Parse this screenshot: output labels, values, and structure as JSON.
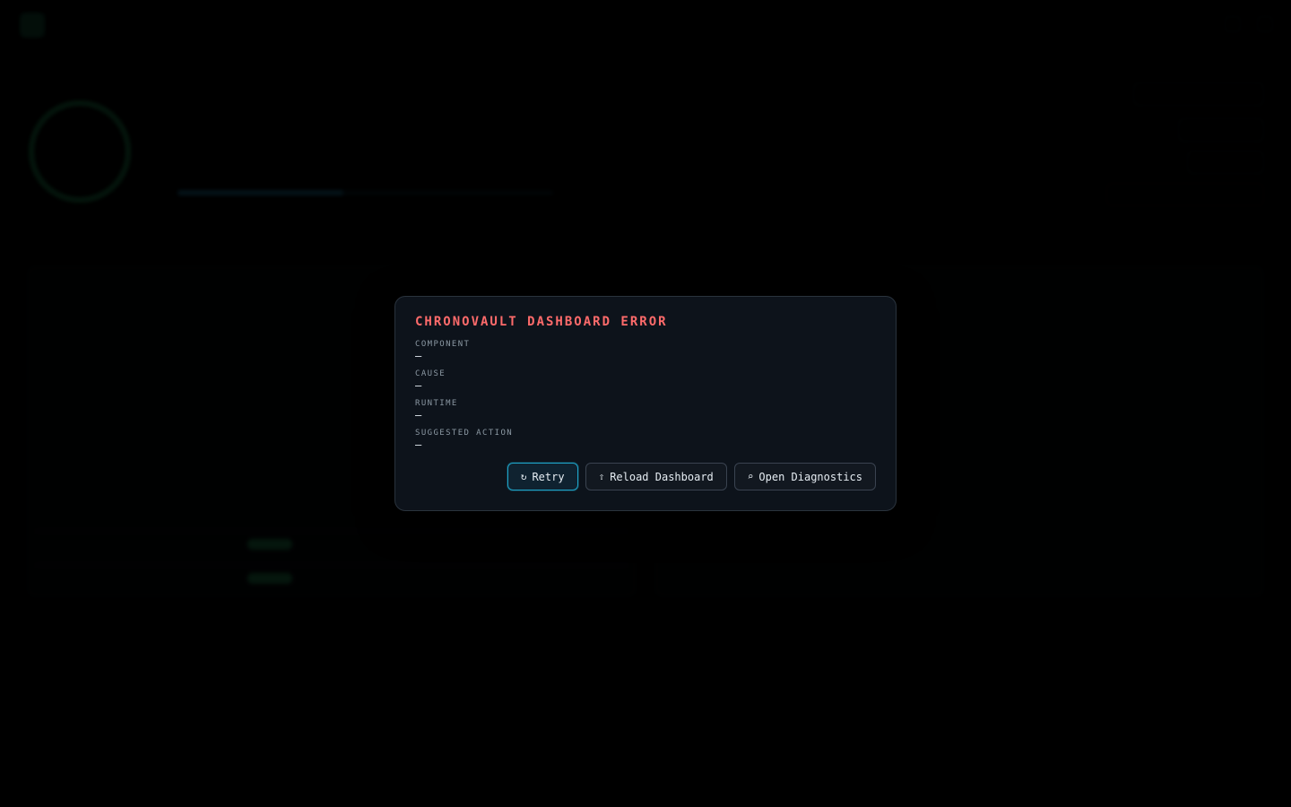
{
  "modal": {
    "title": "CHRONOVAULT DASHBOARD ERROR",
    "fields": [
      {
        "label": "COMPONENT",
        "value": "—"
      },
      {
        "label": "CAUSE",
        "value": "—"
      },
      {
        "label": "RUNTIME",
        "value": "—"
      },
      {
        "label": "SUGGESTED ACTION",
        "value": "—"
      }
    ],
    "buttons": {
      "retry": {
        "icon": "↻",
        "label": "Retry"
      },
      "reload": {
        "icon": "⇧",
        "label": "Reload Dashboard"
      },
      "diagnostics": {
        "icon": "⌕",
        "label": "Open Diagnostics"
      }
    }
  },
  "colors": {
    "error_title": "#ff6b6b",
    "primary_border": "#1fa3c7",
    "modal_bg": "#0d131b"
  }
}
